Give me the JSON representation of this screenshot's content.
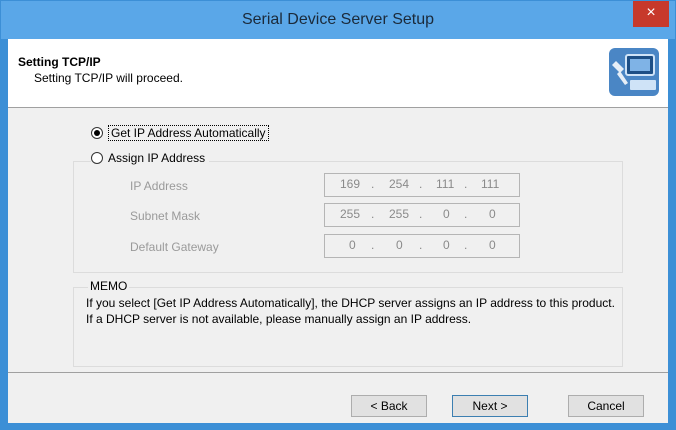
{
  "window": {
    "title": "Serial Device Server Setup",
    "close_glyph": "×"
  },
  "header": {
    "title": "Setting TCP/IP",
    "subtitle": "Setting TCP/IP will proceed.",
    "icon": "network-setup-icon"
  },
  "options": {
    "auto": {
      "label": "Get IP Address Automatically",
      "selected": true
    },
    "manual": {
      "label": "Assign IP Address",
      "selected": false
    }
  },
  "fields": [
    {
      "label": "IP Address",
      "octets": [
        "169",
        "254",
        "111",
        "111"
      ]
    },
    {
      "label": "Subnet Mask",
      "octets": [
        "255",
        "255",
        "0",
        "0"
      ]
    },
    {
      "label": "Default Gateway",
      "octets": [
        "0",
        "0",
        "0",
        "0"
      ]
    }
  ],
  "memo": {
    "title": "MEMO",
    "text": "If you select [Get IP Address Automatically], the DHCP server assigns an IP address to this product. If a DHCP server is not available, please manually assign an IP address."
  },
  "buttons": {
    "back": "< Back",
    "next": "Next >",
    "cancel": "Cancel"
  }
}
